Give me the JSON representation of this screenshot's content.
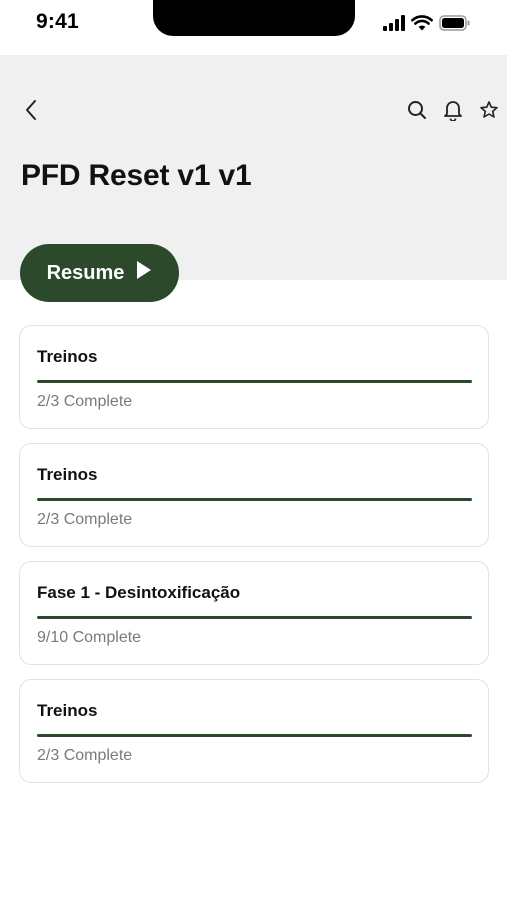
{
  "status_bar": {
    "time": "9:41",
    "icons": [
      "cellular-signal-icon",
      "wifi-icon",
      "battery-icon"
    ]
  },
  "header": {
    "title": "PFD Reset v1 v1",
    "icons": [
      "back-chevron-icon",
      "search-icon",
      "bell-icon",
      "star-icon"
    ]
  },
  "resume_button": {
    "label": "Resume",
    "icon": "play-icon"
  },
  "colors": {
    "accent": "#2c4a2b",
    "header_bg": "#f0f0f0",
    "muted_text": "#7a7a7a"
  },
  "cards": [
    {
      "title": "Treinos",
      "status": "2/3 Complete",
      "progress": 1.0
    },
    {
      "title": "Treinos",
      "status": "2/3 Complete",
      "progress": 1.0
    },
    {
      "title": "Fase 1 - Desintoxificação",
      "status": "9/10 Complete",
      "progress": 1.0
    },
    {
      "title": "Treinos",
      "status": "2/3 Complete",
      "progress": 1.0
    }
  ]
}
